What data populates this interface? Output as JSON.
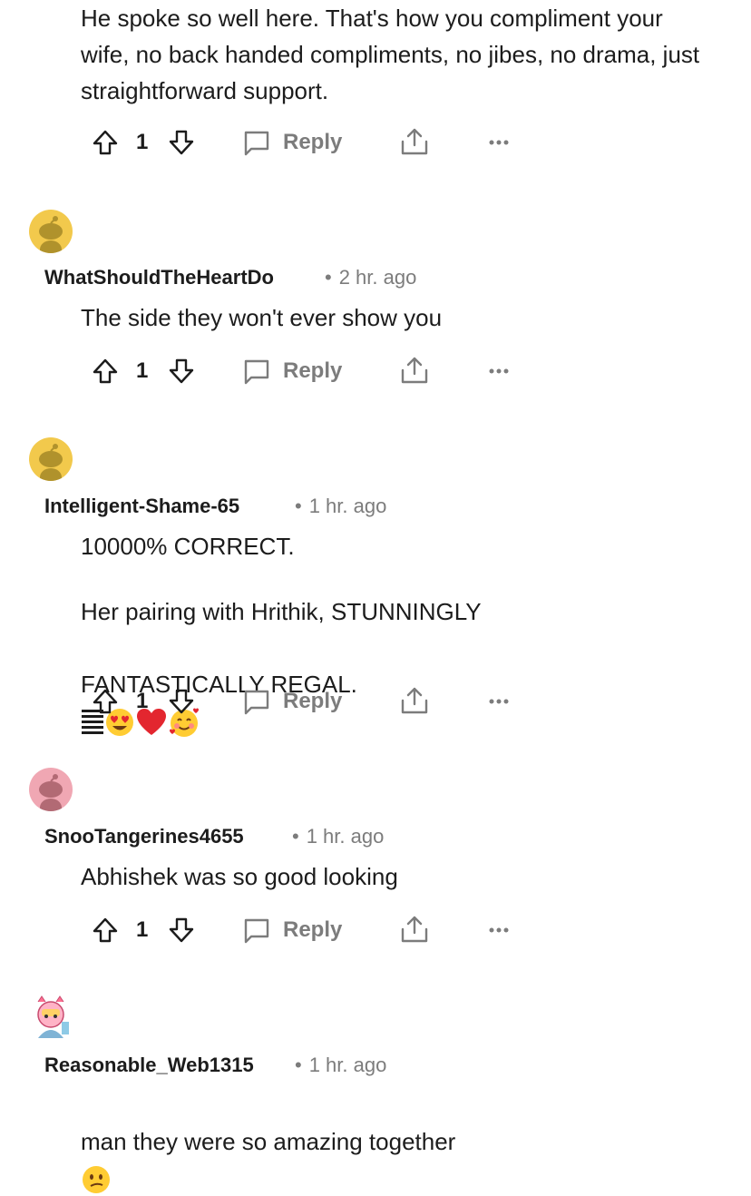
{
  "comments": [
    {
      "username": "",
      "time": "",
      "body": "He spoke so well here. That's how you compliment your wife, no back handed compliments, no jibes, no drama, just straightforward support.",
      "score": "1",
      "reply_label": "Reply"
    },
    {
      "username": "WhatShouldTheHeartDo",
      "time": "2 hr. ago",
      "body": "The side they won't ever show you",
      "score": "1",
      "reply_label": "Reply",
      "avatar_color": "#f2c94c"
    },
    {
      "username": "Intelligent-Shame-65",
      "time": "1 hr. ago",
      "body_line1": "10000% CORRECT.",
      "body_line2": "Her pairing with Hrithik, STUNNINGLY",
      "body_line3": "FANTASTICALLY REGAL.",
      "score": "1",
      "reply_label": "Reply",
      "avatar_color": "#f2c94c"
    },
    {
      "username": "SnooTangerines4655",
      "time": "1 hr. ago",
      "body": "Abhishek was so good looking",
      "score": "1",
      "reply_label": "Reply",
      "avatar_color": "#f0a7b3"
    },
    {
      "username": "Reasonable_Web1315",
      "time": "1 hr. ago",
      "body": "man they were so amazing together"
    }
  ],
  "separator": "•",
  "icons": {
    "upvote": "upvote-arrow-icon",
    "downvote": "downvote-arrow-icon",
    "reply": "speech-bubble-icon",
    "share": "share-upload-icon",
    "more": "more-dots-icon",
    "emoji_hundred_bars": "bars-emoji-icon",
    "emoji_heart_eyes": "heart-eyes-emoji-icon",
    "emoji_red_heart": "red-heart-emoji-icon",
    "emoji_smiling_hearts": "smiling-face-with-hearts-emoji-icon",
    "emoji_confused": "confused-face-emoji-icon"
  }
}
